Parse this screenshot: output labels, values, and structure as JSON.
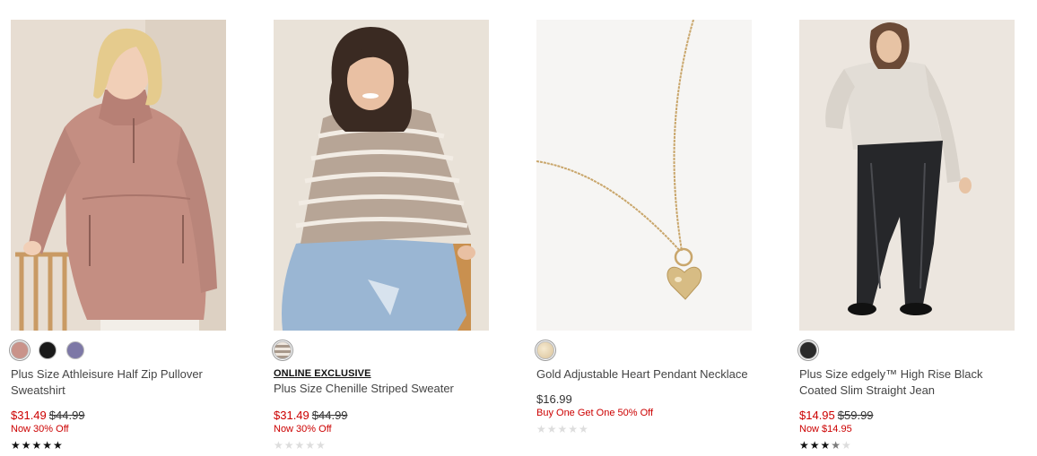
{
  "products": [
    {
      "title": "Plus Size Athleisure Half Zip Pullover Sweatshirt",
      "badge": "",
      "price_now": "$31.49",
      "price_was": "$44.99",
      "promo": "Now 30% Off",
      "rating": 5,
      "swatches": [
        "#c9938a",
        "#1a1a1a",
        "#7d78a6"
      ],
      "image": "model-in-pink-half-zip-sweatshirt"
    },
    {
      "title": "Plus Size Chenille Striped Sweater",
      "badge": "ONLINE EXCLUSIVE",
      "price_now": "$31.49",
      "price_was": "$44.99",
      "promo": "Now 30% Off",
      "rating": 0,
      "swatches": [
        "#a8988a"
      ],
      "image": "model-in-striped-sweater"
    },
    {
      "title": "Gold Adjustable Heart Pendant Necklace",
      "badge": "",
      "price_now": "$16.99",
      "price_was": "",
      "promo": "Buy One Get One 50% Off",
      "rating": 0,
      "swatches": [
        "#e2cfa8"
      ],
      "image": "gold-heart-pendant-necklace"
    },
    {
      "title": "Plus Size edgely™ High Rise Black Coated Slim Straight Jean",
      "badge": "",
      "price_now": "$14.95",
      "price_was": "$59.99",
      "promo": "Now $14.95",
      "rating": 3.5,
      "swatches": [
        "#2a2a2a"
      ],
      "image": "model-in-black-coated-jeans"
    }
  ]
}
